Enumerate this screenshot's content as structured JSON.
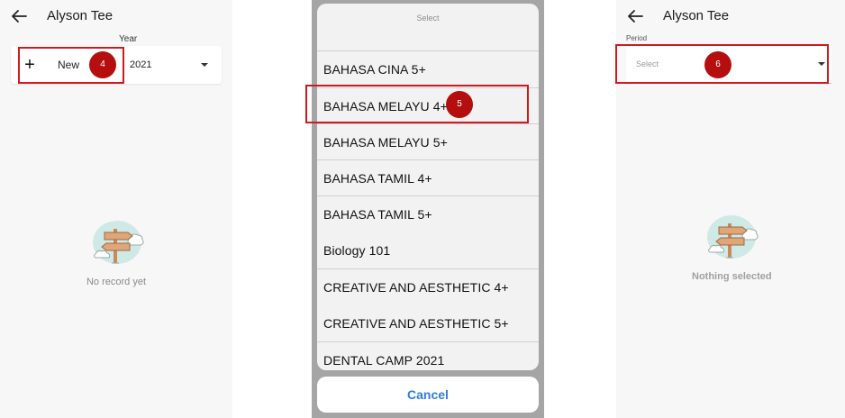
{
  "left": {
    "title": "Alyson Tee",
    "year_label": "Year",
    "new_label": "New",
    "year_value": "2021",
    "badge": "4",
    "empty_text": "No record yet"
  },
  "middle": {
    "sheet_title": "Select",
    "items": [
      "BAHASA CINA 5+",
      "BAHASA MELAYU 4+",
      "BAHASA MELAYU 5+",
      "BAHASA TAMIL 4+",
      "BAHASA TAMIL 5+",
      "Biology 101",
      "CREATIVE AND AESTHETIC 4+",
      "CREATIVE AND AESTHETIC 5+",
      "DENTAL CAMP 2021"
    ],
    "badge": "5",
    "cancel_label": "Cancel"
  },
  "right": {
    "title": "Alyson Tee",
    "period_label": "Period",
    "select_placeholder": "Select",
    "badge": "6",
    "empty_text": "Nothing selected"
  },
  "icons": {
    "back": "back-arrow-icon",
    "add": "plus-icon",
    "dropdown": "caret-down-icon",
    "empty": "signpost-cloud-illustration"
  },
  "colors": {
    "highlight": "#d0191f",
    "badge": "#b50e0e",
    "cancel": "#2d7fd6",
    "empty_illustration_cloud": "#cfe9e6",
    "empty_illustration_sign": "#e0a677"
  }
}
